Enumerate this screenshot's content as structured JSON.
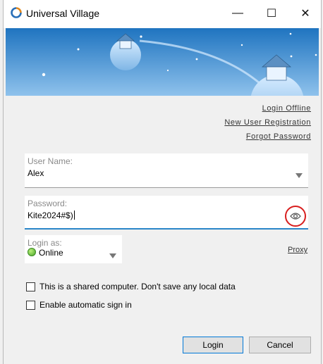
{
  "window": {
    "title": "Universal Village",
    "controls": {
      "minimize": "—",
      "maximize": "☐",
      "close": "✕"
    }
  },
  "links": {
    "login_offline": "Login Offline",
    "new_user_registration": "New User Registration",
    "forgot_password": "Forgot Password"
  },
  "username": {
    "label": "User Name:",
    "value": "Alex"
  },
  "password": {
    "label": "Password:",
    "value": "Kite2024#$)"
  },
  "login_as": {
    "label": "Login as:",
    "value": "Online"
  },
  "proxy": "Proxy",
  "options": {
    "shared_computer": "This is a shared computer. Don't save any local data",
    "auto_signin": "Enable automatic sign in"
  },
  "buttons": {
    "login": "Login",
    "cancel": "Cancel"
  },
  "colors": {
    "banner_top": "#1f74c0",
    "banner_bottom": "#8fc2ec",
    "focus": "#2a86c8",
    "highlight_ring": "#d81e1e",
    "online": "#4aa52a"
  }
}
